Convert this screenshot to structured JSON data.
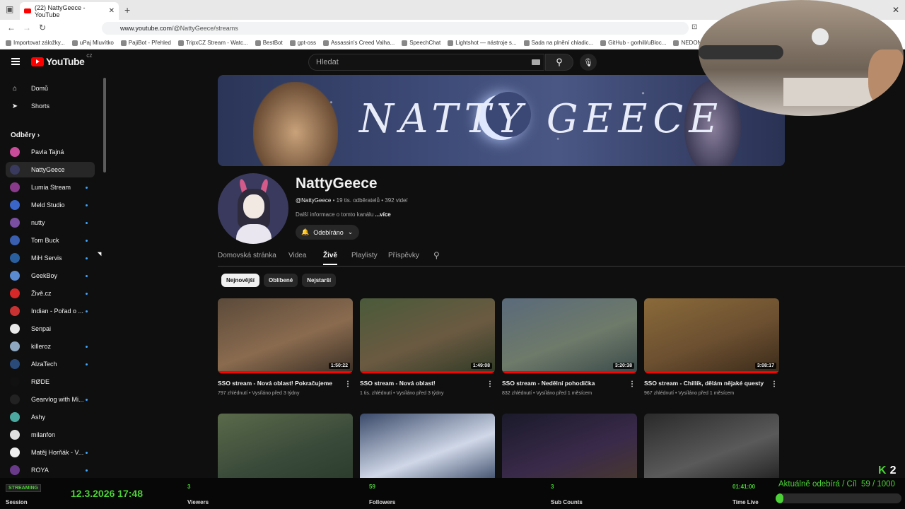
{
  "browser": {
    "tab_title": "(22) NattyGeece - YouTube",
    "url_host": "www.youtube.com",
    "url_path": "/@NattyGeece/streams",
    "bookmarks": [
      "Importovat záložky...",
      "uPaj Mluvítko",
      "PajiBot - Přehled",
      "TripxCZ Stream - Watc...",
      "BestBot",
      "gpt-oss",
      "Assassin's Creed Valha...",
      "SpeechChat",
      "Lightshot — nástroje s...",
      "Sada na plnění chladic...",
      "GitHub - gorhill/uBloc...",
      "NEDONG 8.5x2 Bezdu..."
    ]
  },
  "youtube": {
    "logo_text": "YouTube",
    "region": "CZ",
    "search_placeholder": "Hledat",
    "nav": [
      {
        "label": "Domů",
        "icon": "home-icon"
      },
      {
        "label": "Shorts",
        "icon": "shorts-icon"
      }
    ],
    "subscriptions_heading": "Odběry",
    "subscriptions": [
      {
        "label": "Pavla Tajná",
        "color": "#c94c9a",
        "dot": false
      },
      {
        "label": "NattyGeece",
        "color": "#3a3a5e",
        "dot": false,
        "active": true
      },
      {
        "label": "Lumia Stream",
        "color": "#8a3a8a",
        "dot": true
      },
      {
        "label": "Meld Studio",
        "color": "#3a66c8",
        "dot": true
      },
      {
        "label": "nutty",
        "color": "#7a4ea0",
        "dot": true
      },
      {
        "label": "Tom Buck",
        "color": "#3a5fb0",
        "dot": true
      },
      {
        "label": "MiH Servis",
        "color": "#2a5f9e",
        "dot": true
      },
      {
        "label": "GeekBoy",
        "color": "#5a8ad0",
        "dot": true
      },
      {
        "label": "Živě.cz",
        "color": "#d62828",
        "dot": true
      },
      {
        "label": "Indian - Pořad o ...",
        "color": "#c83232",
        "dot": true
      },
      {
        "label": "Senpai",
        "color": "#e9e9e9",
        "dot": false
      },
      {
        "label": "killeroz",
        "color": "#8fa8c0",
        "dot": true
      },
      {
        "label": "AlzaTech",
        "color": "#2a4a7a",
        "dot": true
      },
      {
        "label": "RØDE",
        "color": "#111111",
        "dot": false
      },
      {
        "label": "Gearvlog with Mi...",
        "color": "#222222",
        "dot": true
      },
      {
        "label": "Ashy",
        "color": "#4aa8a0",
        "dot": false
      },
      {
        "label": "milanfon",
        "color": "#e0e0e0",
        "dot": false
      },
      {
        "label": "Matěj Horňák - V...",
        "color": "#eeeeee",
        "dot": true
      },
      {
        "label": "ROYA",
        "color": "#6a3a8a",
        "dot": true
      }
    ],
    "channel": {
      "name": "NattyGeece",
      "handle": "@NattyGeece",
      "subscribers": "19 tis. odběratelů",
      "videos": "392 videí",
      "more_info": "Další informace o tomto kanálu",
      "more_link": "...více",
      "subscribed_label": "Odebíráno",
      "banner_text": "NATTY GEECE"
    },
    "channel_tabs": [
      "Domovská stránka",
      "Videa",
      "Živě",
      "Playlisty",
      "Příspěvky"
    ],
    "active_tab": 2,
    "filter_chips": [
      "Nejnovější",
      "Oblíbené",
      "Nejstarší"
    ],
    "videos": [
      {
        "title": "SSO stream - Nová oblast! Pokračujeme",
        "views": "797 zhlédnutí",
        "when": "Vysíláno před 3 týdny",
        "duration": "1:50:22",
        "colors": [
          "#5b4a3a",
          "#8a6b4f",
          "#3a2f25"
        ]
      },
      {
        "title": "SSO stream - Nová oblast!",
        "views": "1 tis. zhlédnutí",
        "when": "Vysíláno před 3 týdny",
        "duration": "1:49:08",
        "colors": [
          "#4a5a3a",
          "#6b5a42",
          "#2f3a25"
        ]
      },
      {
        "title": "SSO stream - Nedělní pohodička",
        "views": "832 zhlédnutí",
        "when": "Vysíláno před 1 měsícem",
        "duration": "3:20:38",
        "colors": [
          "#5a6a7a",
          "#6e7a6a",
          "#3a4a4a"
        ]
      },
      {
        "title": "SSO stream - Chillík, dělám nějaké questy",
        "views": "967 zhlédnutí",
        "when": "Vysíláno před 1 měsícem",
        "duration": "3:08:17",
        "colors": [
          "#8a6a3a",
          "#6b4f30",
          "#3a2a1a"
        ]
      },
      {
        "title": "",
        "views": "",
        "when": "",
        "duration": "",
        "colors": [
          "#5a6a4a",
          "#3a4a3a",
          "#2a3a2a"
        ]
      },
      {
        "title": "",
        "views": "",
        "when": "",
        "duration": "",
        "colors": [
          "#3a4a6a",
          "#d0d8e8",
          "#2a3a5a"
        ]
      },
      {
        "title": "",
        "views": "",
        "when": "",
        "duration": "",
        "colors": [
          "#1a1a2a",
          "#3a2a4a",
          "#4a3a2a"
        ]
      },
      {
        "title": "",
        "views": "",
        "when": "",
        "duration": "",
        "colors": [
          "#2a2a2a",
          "#5a5a5a",
          "#1a1a1a"
        ]
      }
    ]
  },
  "overlay": {
    "streaming_label": "STREAMING",
    "session_label": "Session",
    "datetime": "12.3.2026 17:48",
    "stats": [
      {
        "value": "3",
        "label": "Viewers"
      },
      {
        "value": "59",
        "label": "Followers"
      },
      {
        "value": "3",
        "label": "Sub Counts"
      },
      {
        "value": "01:41:00",
        "label": "Time Live"
      }
    ],
    "goal_text": "Aktuálně odebírá / Cíl",
    "goal_value": "59 / 1000",
    "goal_fraction": 0.059,
    "kick_count": "2",
    "accent": "#4cd137"
  }
}
